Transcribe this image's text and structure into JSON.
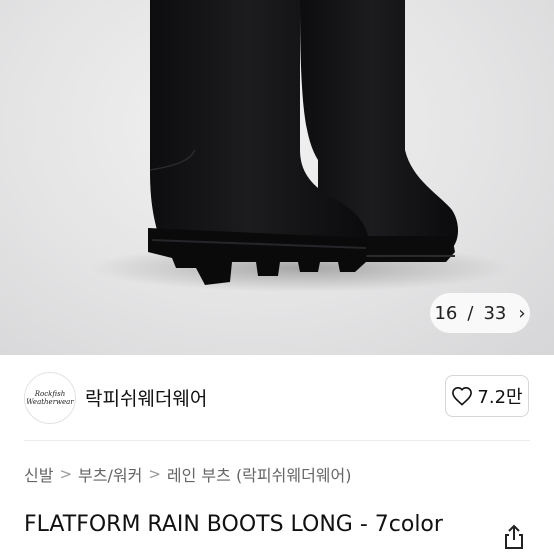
{
  "gallery": {
    "current": "16",
    "separator": "/",
    "total": "33",
    "chevron": "›"
  },
  "seller": {
    "name": "락피쉬웨더웨어",
    "logo_line1": "Rockfish",
    "logo_line2": "Weatherwear"
  },
  "like": {
    "count": "7.2만",
    "icon": "heart-outline-icon"
  },
  "breadcrumb": {
    "items": [
      "신발",
      "부츠/워커",
      "레인 부츠 (락피쉬웨더웨어)"
    ],
    "separator": ">"
  },
  "product": {
    "title": "FLATFORM RAIN BOOTS LONG - 7color"
  },
  "icons": {
    "share": "share-icon"
  },
  "colors": {
    "photo_background": "#e4e4e5",
    "boot": "#141416",
    "text_primary": "#111111",
    "text_secondary": "#666666",
    "border": "#d6d6d6"
  }
}
